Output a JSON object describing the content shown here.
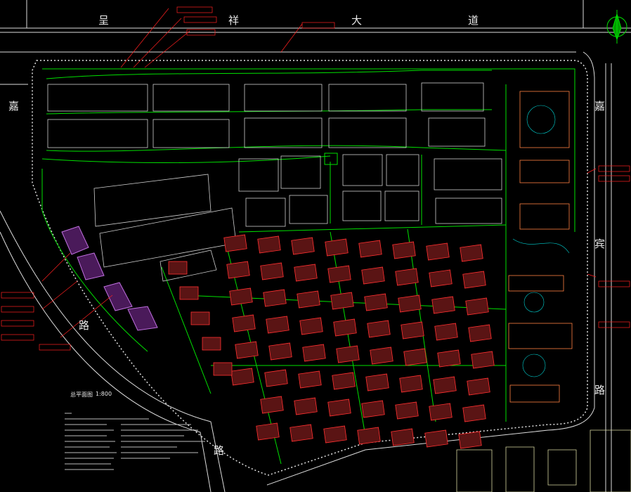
{
  "roads": {
    "north_chars": [
      "呈",
      "祥",
      "大",
      "道"
    ],
    "east_chars": [
      "嘉",
      "宾",
      "路"
    ],
    "west_chars": [
      "嘉",
      "路"
    ],
    "southwest_chars": [
      "路"
    ]
  },
  "plan_title": "总平面图",
  "plan_scale": "1:800",
  "colors": {
    "background": "#000000",
    "boundary_road": "#e0e0e0",
    "site_line": "#00e600",
    "apartment_block": "#cfcfcf",
    "villa_outline": "#ff3030",
    "villa_fill": "#7a2020",
    "commercial": "#b060d0",
    "clubhouse": "#ff8040",
    "annotation": "#ff2020",
    "dimension": "#00d0d0"
  }
}
